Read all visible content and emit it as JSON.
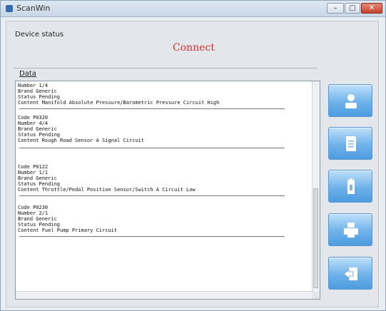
{
  "window": {
    "title": "ScanWin",
    "controls": {
      "minimize": "–",
      "maximize": "□",
      "close": "✕"
    }
  },
  "device_status": {
    "label": "Device status",
    "value": "Connect",
    "value_color": "#d23030"
  },
  "data": {
    "label": "Data",
    "entries": [
      {
        "lines": [
          "Number 1/4",
          "Brand Generic",
          "Status Pending",
          "Content Manifold Absolute Pressure/Barometric Pressure Circuit High"
        ]
      },
      {
        "lines": [
          "Code P0320",
          "Number 4/4",
          "Brand Generic",
          "Status Pending",
          "Content Rough Road Sensor A Signal Circuit"
        ]
      },
      {
        "lines": [
          "Code P0122",
          "Number 1/1",
          "Brand Generic",
          "Status Pending",
          "Content Throttle/Pedal Position Sensor/Switch A Circuit Low"
        ]
      },
      {
        "lines": [
          "Code P0230",
          "Number 2/1",
          "Brand Generic",
          "Status Pending",
          "Content Fuel Pump Primary Circuit"
        ]
      }
    ]
  },
  "side_buttons": [
    {
      "name": "person-icon"
    },
    {
      "name": "document-icon"
    },
    {
      "name": "clipboard-icon"
    },
    {
      "name": "printer-icon"
    },
    {
      "name": "exit-icon"
    }
  ],
  "colors": {
    "button_blue": "#6fb2ea",
    "status_red": "#d23030"
  }
}
